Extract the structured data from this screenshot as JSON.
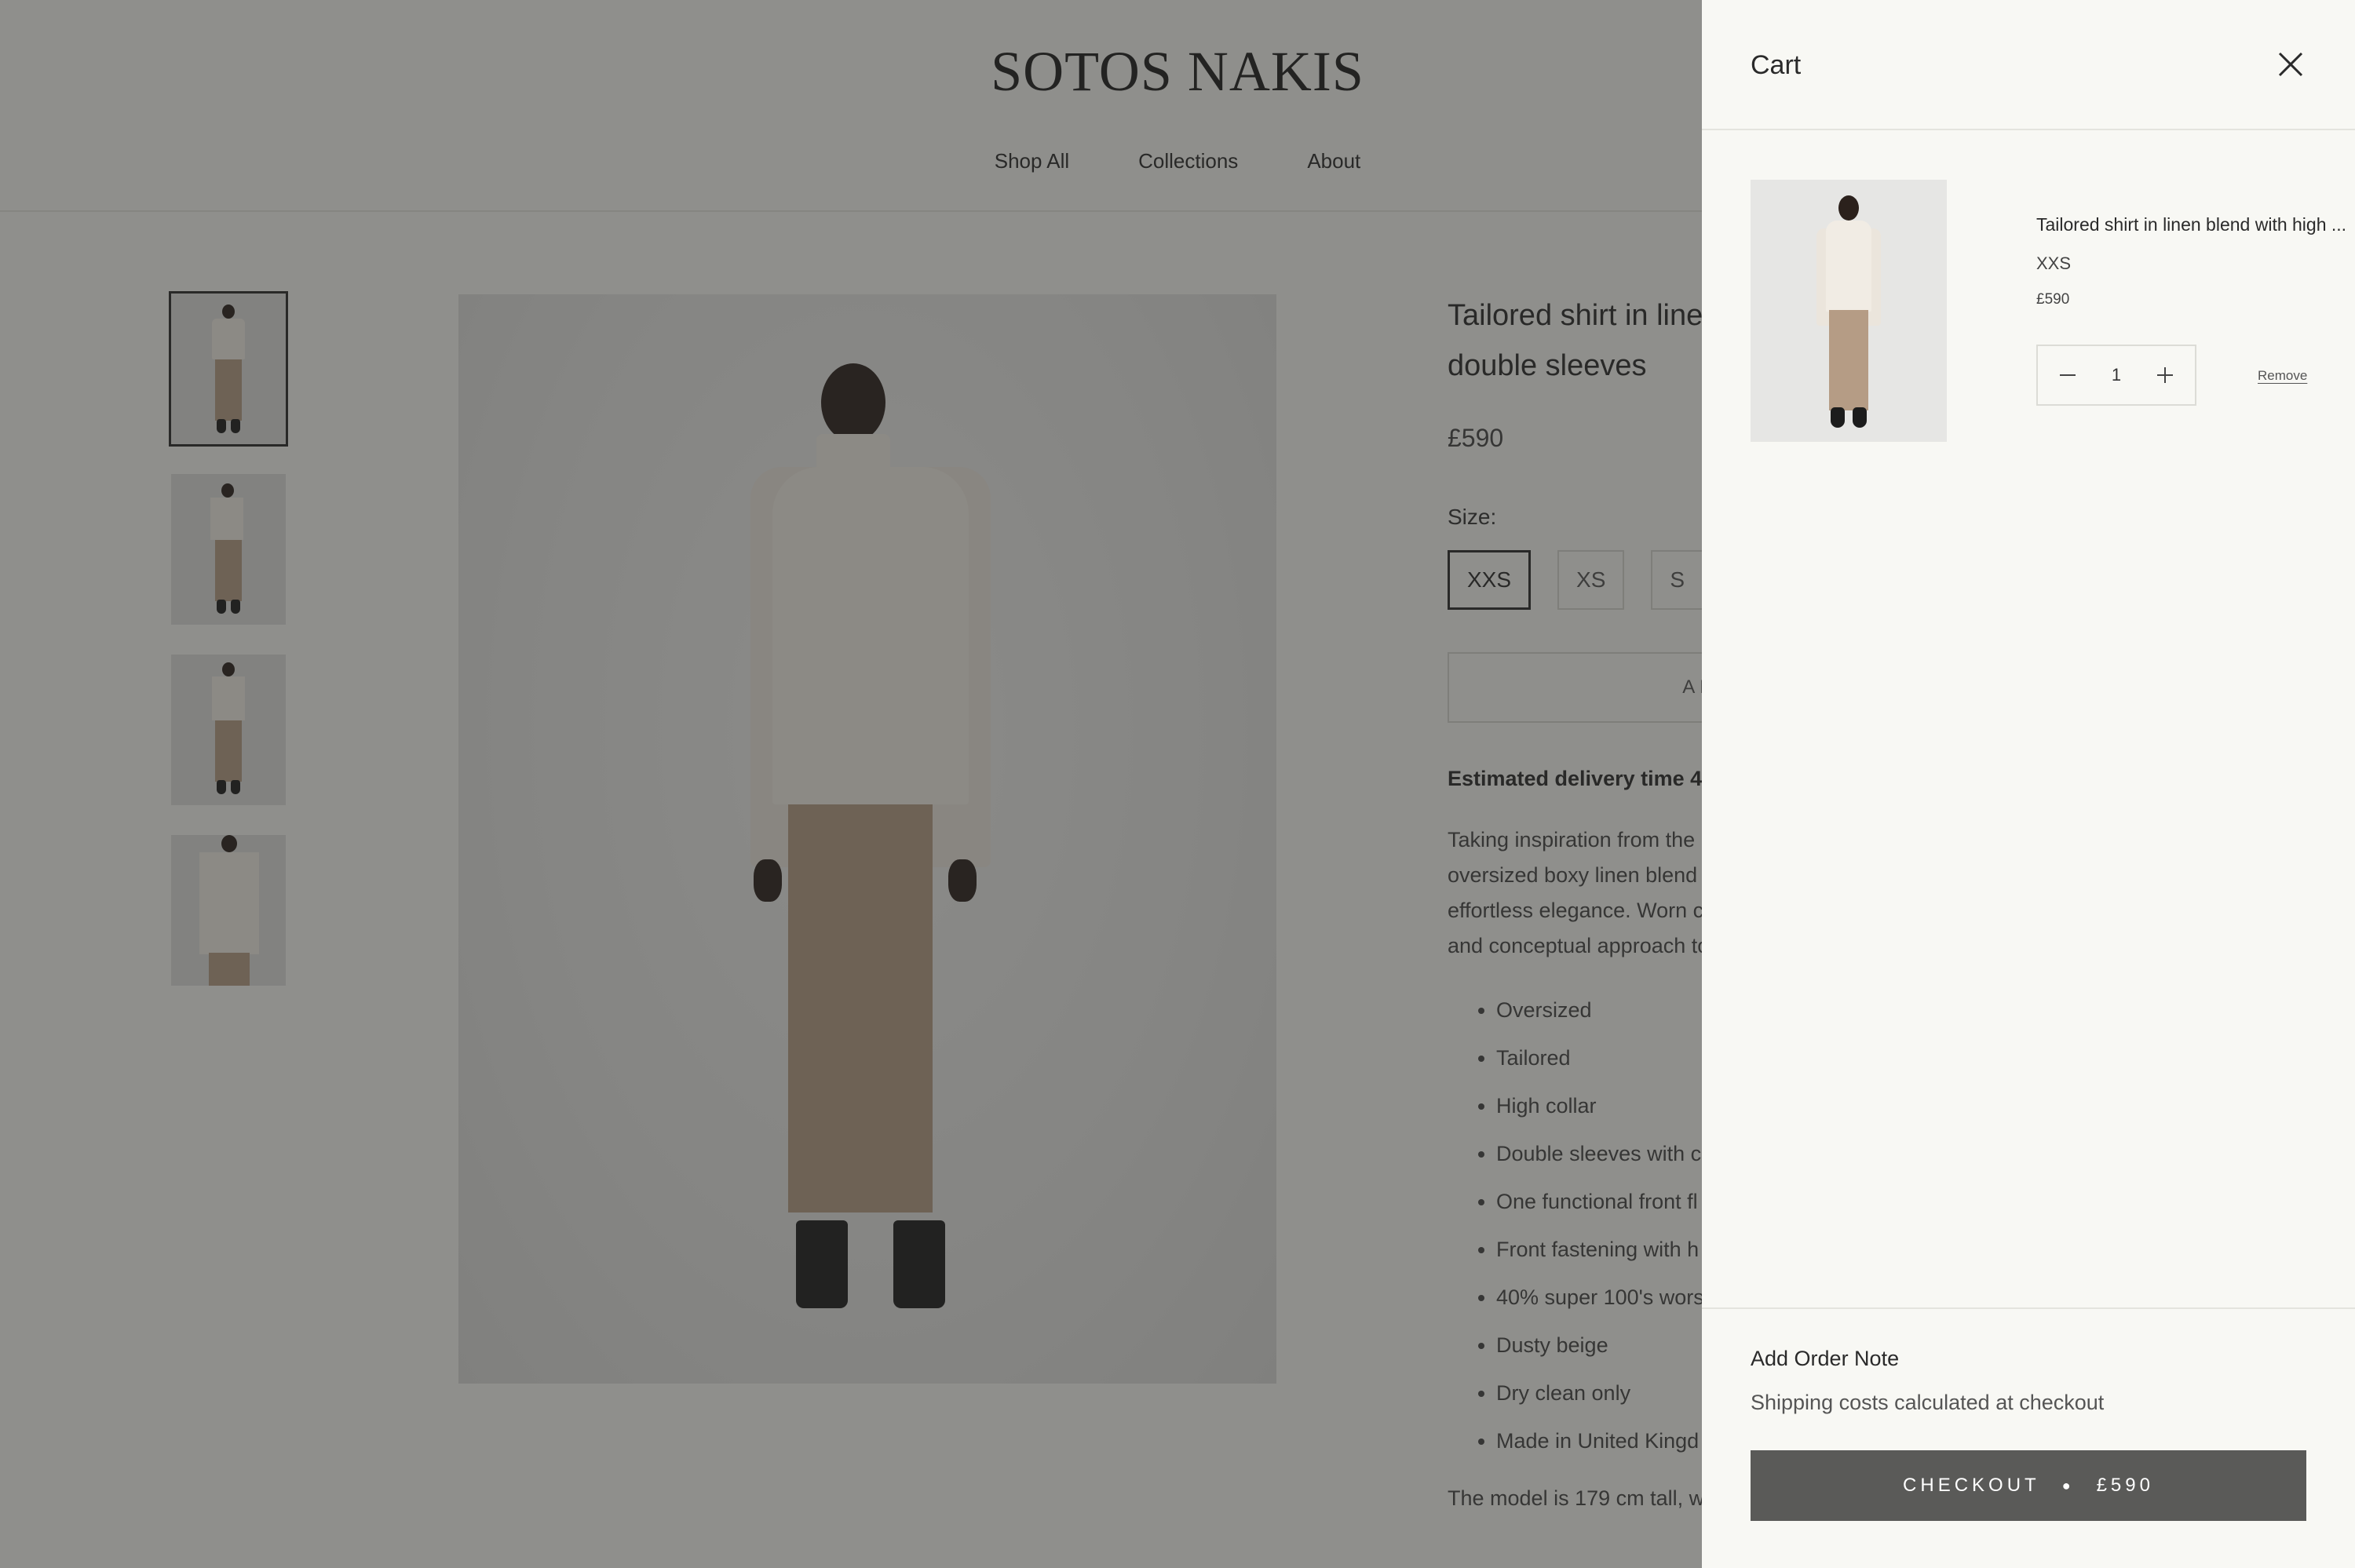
{
  "header": {
    "logo": "SOTOS NAKIS",
    "nav": [
      "Shop All",
      "Collections",
      "About"
    ]
  },
  "product": {
    "title_line1": "Tailored shirt in line",
    "title_line2": "double sleeves",
    "price": "£590",
    "size_label": "Size:",
    "sizes": [
      "XXS",
      "XS",
      "S"
    ],
    "selected_size": "XXS",
    "add_to_cart": "ADD T",
    "delivery": "Estimated delivery time 4",
    "description_lines": [
      "Taking inspiration from the",
      "oversized boxy linen blend",
      "effortless elegance. Worn c",
      "and conceptual approach to"
    ],
    "bullets": [
      "Oversized",
      "Tailored",
      "High collar",
      "Double sleeves with c",
      "One functional front fl",
      "Front fastening with h",
      "40% super 100's wors",
      "Dusty beige",
      "Dry clean only",
      "Made in United Kingd"
    ],
    "model_note": "The model is 179 cm tall, w"
  },
  "cart": {
    "title": "Cart",
    "item": {
      "name": "Tailored shirt in linen blend with high ...",
      "size": "XXS",
      "price": "£590",
      "quantity": "1",
      "remove_label": "Remove"
    },
    "order_note": "Add Order Note",
    "shipping_note": "Shipping costs calculated at checkout",
    "checkout_label": "CHECKOUT",
    "checkout_total": "£590"
  },
  "colors": {
    "overlay": "#6b6b69",
    "drawer_bg": "#f8f8f4",
    "checkout_bg": "#5a5a58",
    "pants": "#b59c85",
    "shirt": "#f1ece4"
  },
  "icons": {
    "close": "close-icon",
    "minus": "minus-icon",
    "plus": "plus-icon"
  }
}
